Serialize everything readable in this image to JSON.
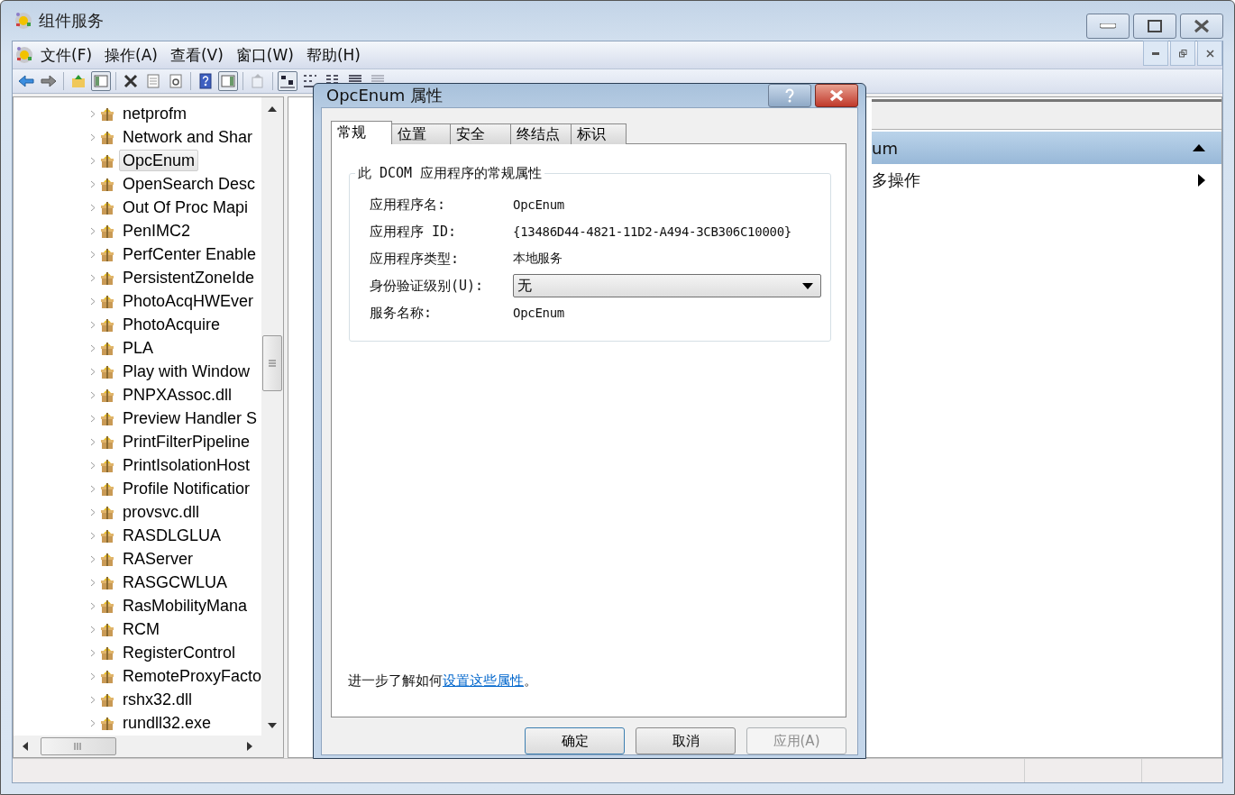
{
  "window": {
    "title": "组件服务"
  },
  "menu": [
    {
      "label": "文件(F)"
    },
    {
      "label": "操作(A)"
    },
    {
      "label": "查看(V)"
    },
    {
      "label": "窗口(W)"
    },
    {
      "label": "帮助(H)"
    }
  ],
  "toolbar": [
    {
      "kind": "back",
      "disabled": false,
      "pressed": false
    },
    {
      "kind": "forward",
      "disabled": false,
      "pressed": false
    },
    {
      "kind": "sep"
    },
    {
      "kind": "up",
      "disabled": false,
      "pressed": false
    },
    {
      "kind": "tree",
      "disabled": false,
      "pressed": true
    },
    {
      "kind": "sep"
    },
    {
      "kind": "delete",
      "disabled": false,
      "pressed": false
    },
    {
      "kind": "properties",
      "disabled": false,
      "pressed": false
    },
    {
      "kind": "refresh",
      "disabled": false,
      "pressed": false
    },
    {
      "kind": "sep"
    },
    {
      "kind": "help",
      "disabled": false,
      "pressed": false
    },
    {
      "kind": "actionpane",
      "disabled": false,
      "pressed": true
    },
    {
      "kind": "sep"
    },
    {
      "kind": "export",
      "disabled": true,
      "pressed": false
    },
    {
      "kind": "sep"
    },
    {
      "kind": "largeicons",
      "disabled": false,
      "pressed": true
    },
    {
      "kind": "smallicons",
      "disabled": false,
      "pressed": false
    },
    {
      "kind": "list",
      "disabled": false,
      "pressed": false
    },
    {
      "kind": "details",
      "disabled": false,
      "pressed": false
    },
    {
      "kind": "details",
      "disabled": true,
      "pressed": false
    }
  ],
  "tree": [
    {
      "label": "netprofm",
      "selected": false
    },
    {
      "label": "Network and Shar",
      "selected": false
    },
    {
      "label": "OpcEnum",
      "selected": true
    },
    {
      "label": "OpenSearch Desc",
      "selected": false
    },
    {
      "label": "Out Of Proc Mapi",
      "selected": false
    },
    {
      "label": "PenIMC2",
      "selected": false
    },
    {
      "label": "PerfCenter Enable",
      "selected": false
    },
    {
      "label": "PersistentZoneIde",
      "selected": false
    },
    {
      "label": "PhotoAcqHWEver",
      "selected": false
    },
    {
      "label": "PhotoAcquire",
      "selected": false
    },
    {
      "label": "PLA",
      "selected": false
    },
    {
      "label": "Play with Window",
      "selected": false
    },
    {
      "label": "PNPXAssoc.dll",
      "selected": false
    },
    {
      "label": "Preview Handler S",
      "selected": false
    },
    {
      "label": "PrintFilterPipeline",
      "selected": false
    },
    {
      "label": "PrintIsolationHost",
      "selected": false
    },
    {
      "label": "Profile Notificatior",
      "selected": false
    },
    {
      "label": "provsvc.dll",
      "selected": false
    },
    {
      "label": "RASDLGLUA",
      "selected": false
    },
    {
      "label": "RAServer",
      "selected": false
    },
    {
      "label": "RASGCWLUA",
      "selected": false
    },
    {
      "label": "RasMobilityMana",
      "selected": false
    },
    {
      "label": "RCM",
      "selected": false
    },
    {
      "label": "RegisterControl",
      "selected": false
    },
    {
      "label": "RemoteProxyFacto",
      "selected": false
    },
    {
      "label": "rshx32.dll",
      "selected": false
    },
    {
      "label": "rundll32.exe",
      "selected": false
    }
  ],
  "actions_pane": {
    "header": "um",
    "items": [
      {
        "label": "多操作"
      }
    ]
  },
  "dialog": {
    "title": "OpcEnum 属性",
    "tabs": [
      {
        "label": "常规",
        "selected": true
      },
      {
        "label": "位置",
        "selected": false
      },
      {
        "label": "安全",
        "selected": false
      },
      {
        "label": "终结点",
        "selected": false
      },
      {
        "label": "标识",
        "selected": false
      }
    ],
    "group_title": "此 DCOM 应用程序的常规属性",
    "fields": [
      {
        "kind": "text",
        "label": "应用程序名:",
        "value": "OpcEnum"
      },
      {
        "kind": "text",
        "label": "应用程序 ID:",
        "value": "{13486D44-4821-11D2-A494-3CB306C10000}"
      },
      {
        "kind": "text",
        "label": "应用程序类型:",
        "value": "本地服务"
      },
      {
        "kind": "select",
        "label": "身份验证级别(U):",
        "value": "无"
      },
      {
        "kind": "text",
        "label": "服务名称:",
        "value": "OpcEnum"
      }
    ],
    "learn_more": {
      "prefix": "进一步了解如何",
      "link": "设置这些属性",
      "suffix": "。"
    },
    "buttons": [
      {
        "label": "确定",
        "disabled": false,
        "default": true
      },
      {
        "label": "取消",
        "disabled": false,
        "default": false
      },
      {
        "label": "应用(A)",
        "disabled": true,
        "default": false
      }
    ]
  }
}
